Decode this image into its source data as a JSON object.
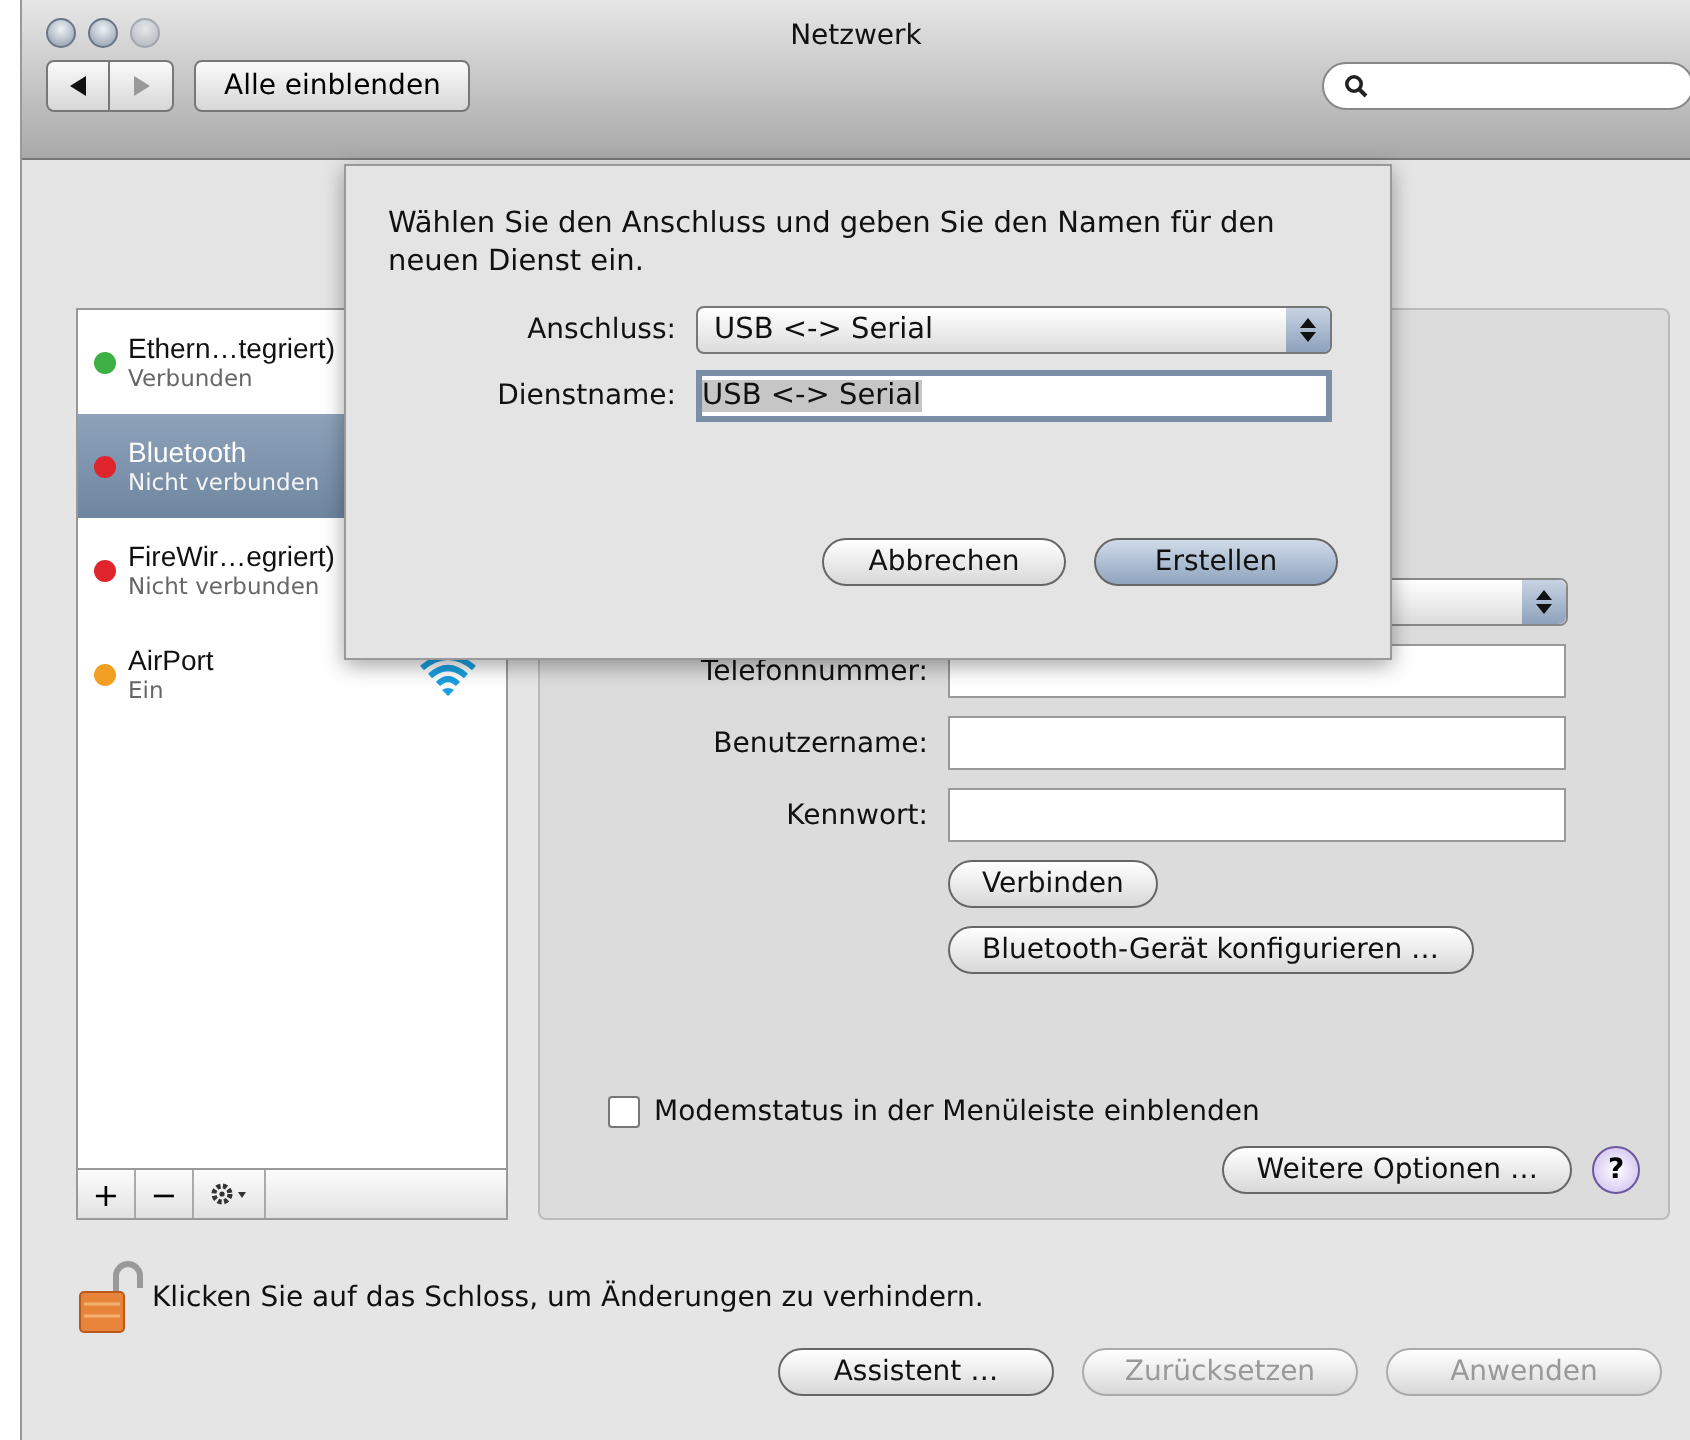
{
  "window": {
    "title": "Netzwerk"
  },
  "toolbar": {
    "show_all": "Alle einblenden"
  },
  "services": [
    {
      "name": "Ethern…tegriert)",
      "status": "Verbunden",
      "color": "#3cb043",
      "selected": false,
      "kind": "ethernet"
    },
    {
      "name": "Bluetooth",
      "status": "Nicht verbunden",
      "color": "#e0242c",
      "selected": true,
      "kind": "bluetooth"
    },
    {
      "name": "FireWir…egriert)",
      "status": "Nicht verbunden",
      "color": "#e0242c",
      "selected": false,
      "kind": "firewire"
    },
    {
      "name": "AirPort",
      "status": "Ein",
      "color": "#f2a024",
      "selected": false,
      "kind": "wifi"
    }
  ],
  "list_buttons": [
    "+",
    "−"
  ],
  "panel": {
    "fields": [
      {
        "label": "Telefonnummer:"
      },
      {
        "label": "Benutzername:"
      },
      {
        "label": "Kennwort:"
      }
    ],
    "connect": "Verbinden",
    "configure": "Bluetooth-Gerät konfigurieren …",
    "modem_status": {
      "label": "Modemstatus in der Menüleiste einblenden",
      "checked": false
    },
    "more_options": "Weitere Optionen …",
    "help": "?"
  },
  "lock": {
    "text": "Klicken Sie auf das Schloss, um Änderungen zu verhindern.",
    "locked": false
  },
  "footer_buttons": [
    {
      "label": "Assistent …",
      "disabled": false
    },
    {
      "label": "Zurücksetzen",
      "disabled": true
    },
    {
      "label": "Anwenden",
      "disabled": true
    }
  ],
  "sheet": {
    "message": "Wählen Sie den Anschluss und geben Sie den Namen für den neuen Dienst ein.",
    "port_label": "Anschluss:",
    "port_value": "USB <-> Serial",
    "name_label": "Dienstname:",
    "name_value": "USB <-> Serial",
    "buttons": [
      {
        "label": "Abbrechen",
        "default": false
      },
      {
        "label": "Erstellen",
        "default": true
      }
    ]
  }
}
